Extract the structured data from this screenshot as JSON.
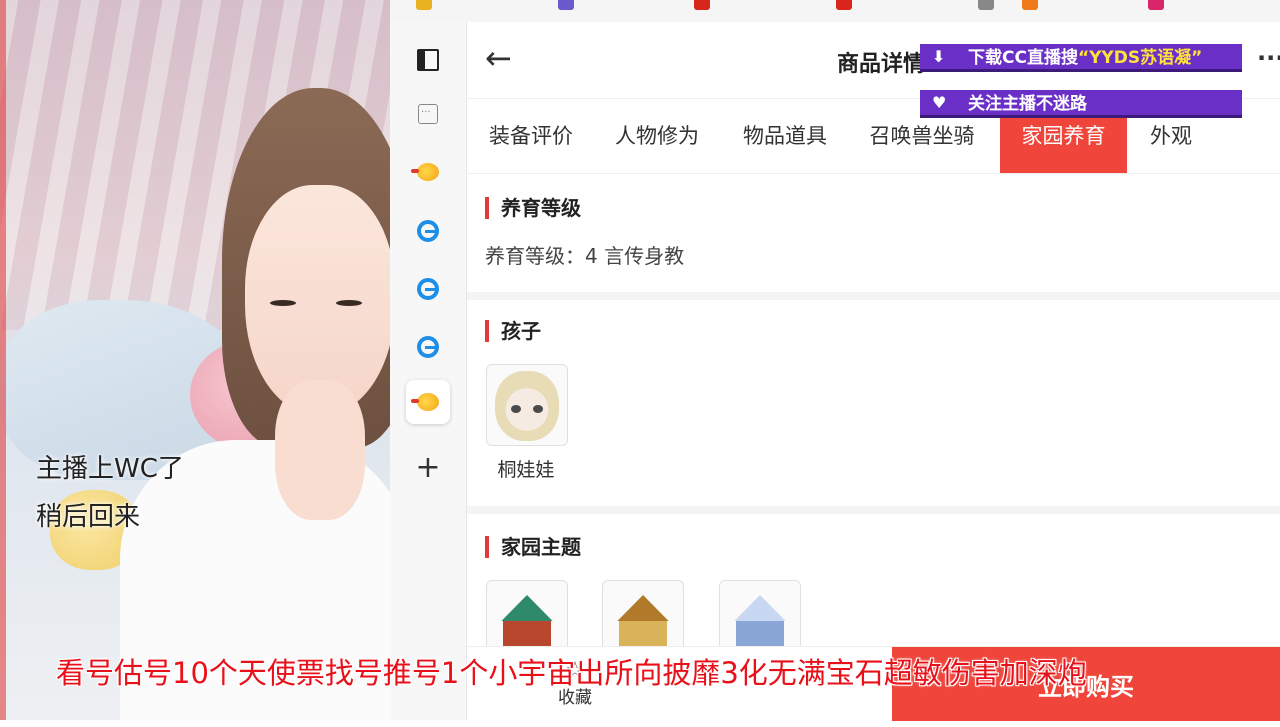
{
  "stream": {
    "notice_line1": "主播上WC了",
    "notice_line2": "稍后回来",
    "banner_download_prefix": "下载CC直播搜",
    "banner_download_highlight": "“YYDS苏语凝”",
    "banner_follow": "关注主播不迷路",
    "ticker": "看号估号10个天使票找号推号1个小宇宙出所向披靡3化无满宝石超敏伤害加深炮"
  },
  "header": {
    "back_icon": "←",
    "title": "商品详情",
    "more_icon": "···"
  },
  "tabs": [
    {
      "label": "装备评价"
    },
    {
      "label": "人物修为"
    },
    {
      "label": "物品道具"
    },
    {
      "label": "召唤兽坐骑"
    },
    {
      "label": "家园养育",
      "active": true
    },
    {
      "label": "外观"
    }
  ],
  "sections": {
    "breeding": {
      "title": "养育等级",
      "text": "养育等级：4  言传身教"
    },
    "children": {
      "title": "孩子",
      "items": [
        {
          "name": "桐娃娃",
          "icon": "doll-icon"
        }
      ]
    },
    "home_theme": {
      "title": "家园主题",
      "items": [
        {
          "icon": "green-roof-house-icon",
          "roof": "#2e8a6a",
          "wall": "#b8472e"
        },
        {
          "icon": "golden-house-icon",
          "roof": "#b07a2a",
          "wall": "#d9b25a"
        },
        {
          "icon": "snow-house-icon",
          "roof": "#c9d8f2",
          "wall": "#8aa6d6"
        }
      ]
    }
  },
  "bottom_bar": {
    "favorite_icon": "☆",
    "favorite_label": "收藏",
    "buy_label": "立即购买"
  },
  "colors": {
    "accent": "#f0453a",
    "banner": "#6a2fc7",
    "ticker": "#e8111a"
  }
}
